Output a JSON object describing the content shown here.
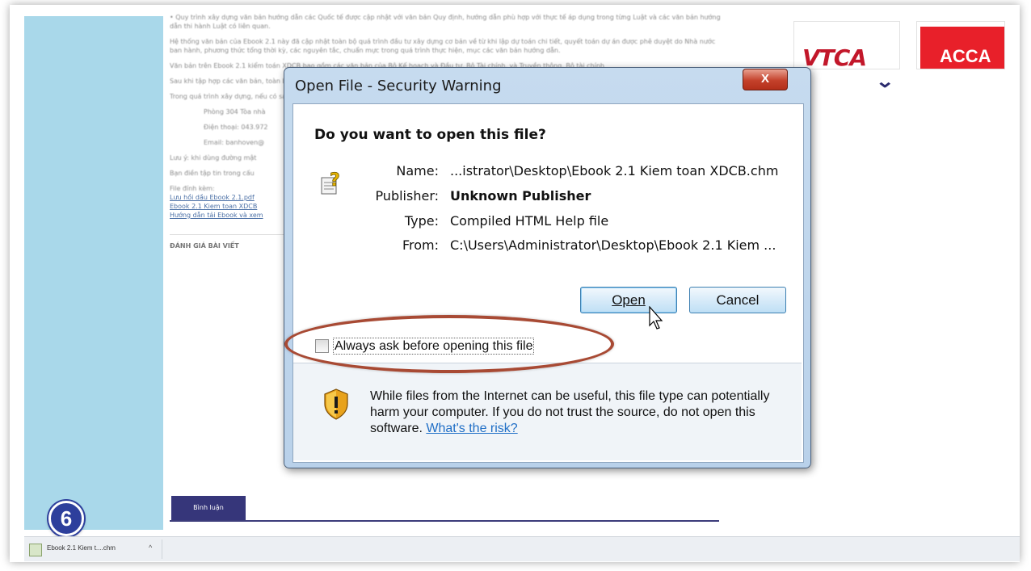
{
  "article": {
    "paragraphs": [
      "• Quy trình xây dựng văn bản hướng dẫn các Quốc tế được cập nhật với văn bản Quy định, hướng dẫn phù hợp với thực tế áp dụng trong từng Luật và các văn bản hướng dẫn thi hành Luật có liên quan.",
      "Hệ thống văn bản của Ebook 2.1 này đã cập nhật toàn bộ quá trình đầu tư xây dựng cơ bản về từ khi lập dự toán chi tiết, quyết toán dự án được phê duyệt do Nhà nước ban hành, phương thức tổng thời kỳ, các nguyên tắc, chuẩn mực trong quá trình thực hiện, mục các văn bản hướng dẫn.",
      "Văn bản trên Ebook 2.1 kiểm toán XDCB bao gồm các văn bản của Bộ Kế hoạch và Đầu tư, Bộ Tài chính, và Truyền thông, Bộ tài chính",
      "Sau khi tập hợp các văn bản, toàn bộ CQTDANT-VACPA 03",
      "Trong quá trình xây dựng, nếu có sai sót, kính mong các kiểm toán viên hành nghề Việt Nam",
      "Phòng 304 Tòa nhà",
      "Điện thoại: 043.972",
      "Email: banhoven@",
      "Lưu ý: khi dùng đường mật",
      "Bạn điền tập tin trong cấu",
      "File đính kèm:"
    ],
    "links": [
      "Lưu hồi dầu Ebook 2.1.pdf",
      "Ebook 2.1 Kiem toan XDCB",
      "Hướng dẫn tải Ebook và xem"
    ],
    "rating_label": "ĐÁNH GIÁ BÀI VIẾT",
    "tab_label": "Bình luận"
  },
  "logos": {
    "vtca": "VTCA",
    "acca": "ACCA"
  },
  "step_number": "6",
  "download_bar": {
    "file_label": "Ebook 2.1 Kiem t....chm"
  },
  "dialog": {
    "title": "Open File - Security Warning",
    "close_label": "X",
    "question": "Do you want to open this file?",
    "fields": [
      {
        "key": "Name:",
        "value": "...istrator\\Desktop\\Ebook 2.1 Kiem toan XDCB.chm",
        "bold": false
      },
      {
        "key": "Publisher:",
        "value": "Unknown Publisher",
        "bold": true
      },
      {
        "key": "Type:",
        "value": "Compiled HTML Help file",
        "bold": false
      },
      {
        "key": "From:",
        "value": "C:\\Users\\Administrator\\Desktop\\Ebook 2.1 Kiem ...",
        "bold": false
      }
    ],
    "open_button": "Open",
    "cancel_button": "Cancel",
    "checkbox_label": "Always ask before opening this file",
    "checkbox_checked": false,
    "warning_text": "While files from the Internet can be useful, this file type can potentially harm your computer. If you do not trust the source, do not open this software.",
    "risk_link": "What's the risk?"
  },
  "colors": {
    "sidebar": "#a9d8ea",
    "annotation_ellipse": "#a84a34",
    "dialog_frame": "#b9d1ea",
    "link": "#1f6ec6"
  },
  "icons": {
    "dialog_file": "help-document-icon",
    "warning": "shield-warning-icon",
    "cursor": "mouse-pointer-icon"
  }
}
